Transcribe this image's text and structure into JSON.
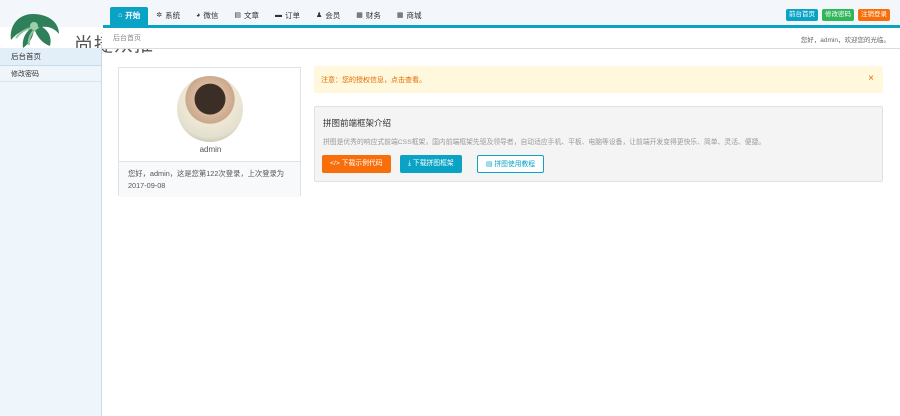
{
  "brand": {
    "name": "尚捷众推"
  },
  "nav": {
    "items": [
      {
        "label": "开始",
        "icon": "home-icon",
        "glyph": "⌂"
      },
      {
        "label": "系统",
        "icon": "gear-icon",
        "glyph": "✲"
      },
      {
        "label": "微信",
        "icon": "wechat-icon",
        "glyph": "◕"
      },
      {
        "label": "文章",
        "icon": "file-icon",
        "glyph": "▤"
      },
      {
        "label": "订单",
        "icon": "order-icon",
        "glyph": "▬"
      },
      {
        "label": "会员",
        "icon": "user-icon",
        "glyph": "♟"
      },
      {
        "label": "财务",
        "icon": "finance-icon",
        "glyph": "▦"
      },
      {
        "label": "商城",
        "icon": "shop-icon",
        "glyph": "▦"
      }
    ]
  },
  "top_buttons": {
    "front": "前台首页",
    "change_password": "修改密码",
    "logout": "注销登录"
  },
  "sidebar": {
    "group": "后台首页",
    "items": [
      {
        "label": "修改密码"
      }
    ]
  },
  "breadcrumb": {
    "text": "后台首页"
  },
  "header": {
    "greeting": "您好，admin，欢迎您的光临。"
  },
  "profile": {
    "name": "admin",
    "login_info": "您好，admin，这是您第122次登录，上次登录为 2017-09-08"
  },
  "notice": {
    "text": "注意：您的授权信息，点击查看。",
    "close": "×"
  },
  "panel": {
    "title": "拼图前端框架介绍",
    "description": "拼图是优秀的响应式前端CSS框架，国内前端框架先驱及领导者，自动适应手机、平板、电脑等设备，让前端开发变得更快乐、简单、灵活、便捷。",
    "buttons": {
      "download_code": "下载示例代码",
      "download_framework": "下载拼图框架",
      "docs": "拼图使用教程"
    }
  },
  "colors": {
    "accent": "#0aa3c6",
    "orange": "#f86e0a",
    "green": "#31b65a",
    "notice_bg": "#fff8dc"
  }
}
